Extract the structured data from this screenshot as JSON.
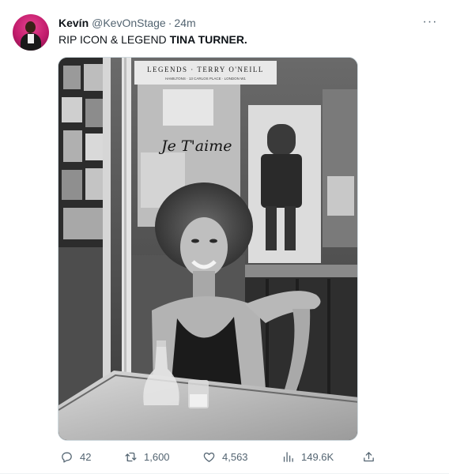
{
  "tweet": {
    "author_name": "Kevín",
    "handle": "@KevOnStage",
    "separator": "·",
    "time": "24m",
    "text_prefix": "RIP ICON & LEGEND ",
    "text_bold": "TINA TURNER.",
    "more_glyph": "···"
  },
  "media": {
    "poster_text": "LEGENDS · TERRY O'NEILL",
    "poster_subtext": "HAMILTONS · 13 CARLOS PLACE · LONDON W1",
    "graffiti_text": "Je T'aime"
  },
  "actions": {
    "replies": "42",
    "retweets": "1,600",
    "likes": "4,563",
    "views": "149.6K"
  },
  "icons": {
    "reply": "reply-bubble-icon",
    "retweet": "retweet-arrows-icon",
    "like": "heart-icon",
    "views": "bar-chart-icon",
    "share": "share-upload-icon"
  },
  "colors": {
    "text": "#0f1419",
    "secondary": "#536471",
    "avatar_bg": "#c21c6c"
  }
}
